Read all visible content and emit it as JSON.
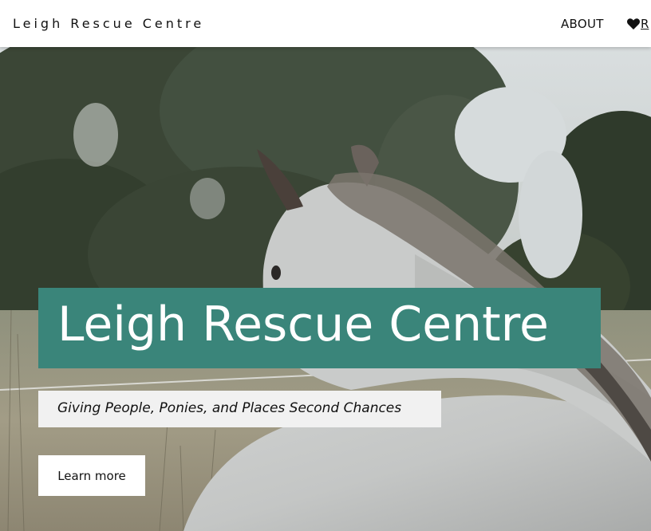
{
  "header": {
    "brand": "Leigh Rescue Centre",
    "nav": {
      "about": "ABOUT",
      "rescue_partial": "R"
    }
  },
  "hero": {
    "title": "Leigh Rescue Centre",
    "tagline": "Giving People, Ponies, and Places Second Chances",
    "cta_label": "Learn more"
  },
  "colors": {
    "accent": "#3a857a",
    "tagline_bg": "#f1f1f1",
    "header_bg": "#ffffff"
  },
  "icons": {
    "nav_rescue": "heart-icon"
  }
}
